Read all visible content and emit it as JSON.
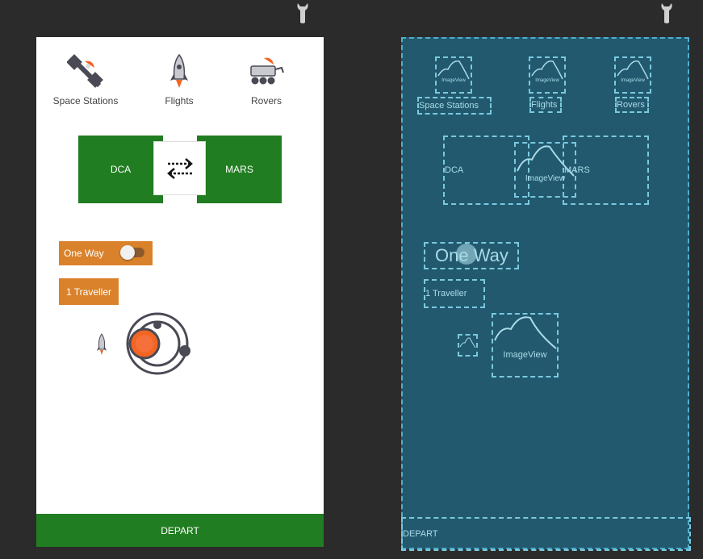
{
  "design": {
    "categories": [
      {
        "label": "Space Stations",
        "icon": "satellite-icon"
      },
      {
        "label": "Flights",
        "icon": "rocket-icon"
      },
      {
        "label": "Rovers",
        "icon": "rover-icon"
      }
    ],
    "origin": "DCA",
    "destination": "MARS",
    "swap_icon": "swap-arrows-icon",
    "trip_type_label": "One Way",
    "trip_toggle_on": false,
    "traveller_label": "1 Traveller",
    "depart_label": "DEPART",
    "colors": {
      "green": "#217d21",
      "orange": "#d9822b",
      "accent": "#f26522"
    }
  },
  "blueprint": {
    "image_label": "ImageView",
    "categories": [
      "Space Stations",
      "Flights",
      "Rovers"
    ],
    "origin": "DCA",
    "destination": "MARS",
    "trip_type_label": "One Way",
    "traveller_label": "1 Traveller",
    "depart_label": "DEPART",
    "colors": {
      "background": "#22596e",
      "outline": "#7ac9df"
    }
  }
}
